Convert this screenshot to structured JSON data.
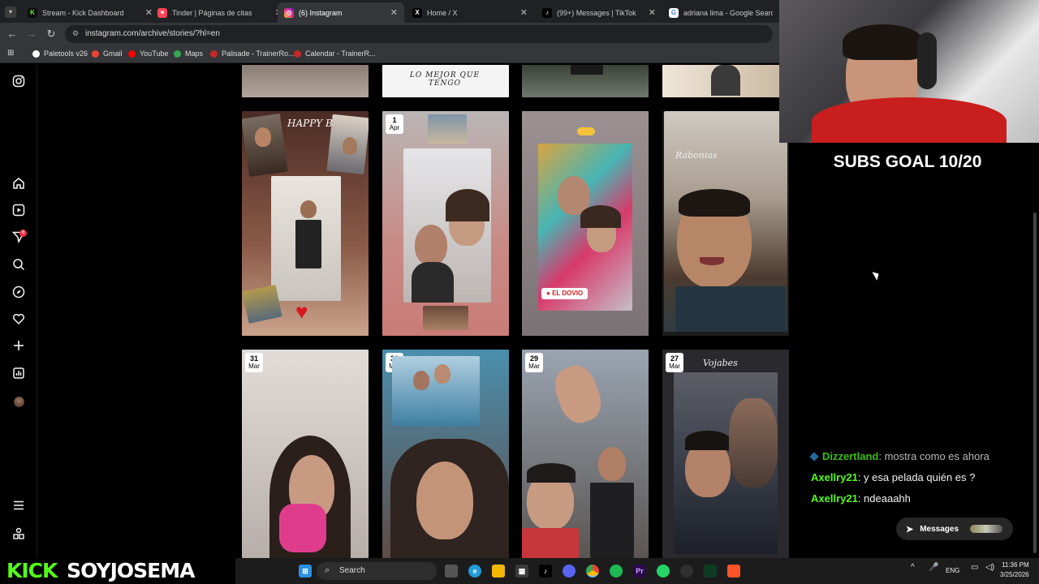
{
  "tabs": [
    {
      "title": "Stream - Kick Dashboard",
      "color": "#53fc18",
      "glyph": "K"
    },
    {
      "title": "Tinder | Páginas de citas",
      "color": "#ff4458",
      "glyph": "♥"
    },
    {
      "title": "(6) Instagram",
      "color": "#d6249f",
      "glyph": "◎"
    },
    {
      "title": "Home / X",
      "color": "#000000",
      "glyph": "X"
    },
    {
      "title": "(99+) Messages | TikTok",
      "color": "#000000",
      "glyph": "♪"
    },
    {
      "title": "adriana lima - Google Search",
      "color": "#4285f4",
      "glyph": "G"
    }
  ],
  "url": "instagram.com/archive/stories/?hl=en",
  "bookmarks": [
    {
      "label": "Paletools v26",
      "color": "#ffffff"
    },
    {
      "label": "Gmail",
      "color": "#ea4335"
    },
    {
      "label": "YouTube",
      "color": "#ff0000"
    },
    {
      "label": "Maps",
      "color": "#34a853"
    },
    {
      "label": "Palisade - TrainerRo...",
      "color": "#c62828"
    },
    {
      "label": "Calendar - TrainerR...",
      "color": "#c62828"
    }
  ],
  "sidebar": {
    "notifications_badge": "6"
  },
  "stories": {
    "top_row_caption": "LO MEJOR QUE TENGO",
    "row2": [
      {
        "day": "",
        "month": "",
        "caption": "HAPPY Birthday",
        "bg": "#6b3b2c"
      },
      {
        "day": "1",
        "month": "Apr",
        "caption": "",
        "bg": "#c77e7a"
      },
      {
        "day": "",
        "month": "",
        "caption": "EL DOVIO",
        "bg": "#8b8285"
      },
      {
        "day": "",
        "month": "",
        "caption": "Rabonias",
        "bg": "#7a6b5a"
      }
    ],
    "row3": [
      {
        "day": "31",
        "month": "Mar",
        "caption": "",
        "bg": "#c9c2bf"
      },
      {
        "day": "30",
        "month": "Mar",
        "caption": "",
        "bg": "#5a8ea8"
      },
      {
        "day": "29",
        "month": "Mar",
        "caption": "",
        "bg": "#6b6f78"
      },
      {
        "day": "27",
        "month": "Mar",
        "caption": "Vojabes",
        "bg": "#2e2d33"
      }
    ]
  },
  "stream": {
    "subs_goal": "SUBS GOAL 10/20",
    "chat": [
      {
        "user": "Dizzertland",
        "message": ": mostra como es ahora",
        "faded": true
      },
      {
        "user": "Axellry21",
        "message": ": y esa pelada quién es ?",
        "faded": false
      },
      {
        "user": "Axellry21",
        "message": ": ndeaaahh",
        "faded": false
      }
    ],
    "messages_label": "Messages",
    "brand_kick": "KICK",
    "brand_name": "SOYJOSEMA"
  },
  "taskbar": {
    "search_placeholder": "Search",
    "lang": "ENG",
    "time": "11:36 PM",
    "date": "3/25/2026"
  }
}
